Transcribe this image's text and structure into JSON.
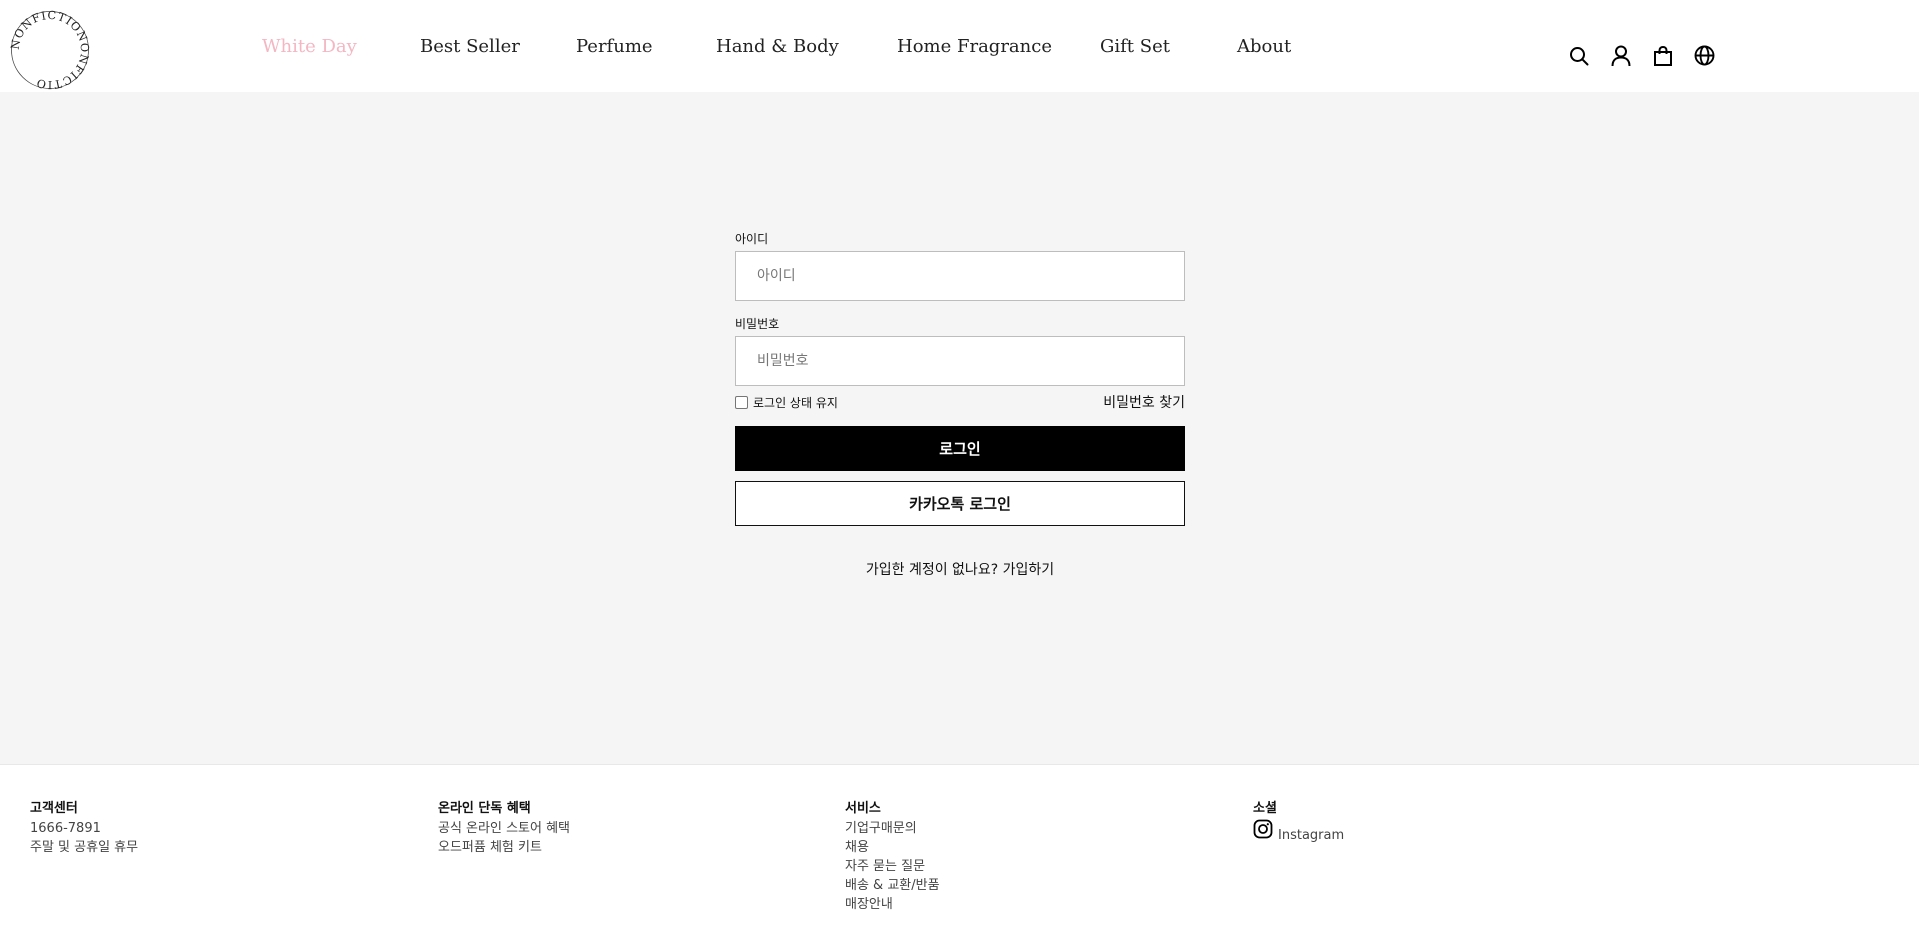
{
  "header": {
    "logo_text": "NONFICTION",
    "nav": [
      {
        "label": "White Day",
        "active": true
      },
      {
        "label": "Best Seller"
      },
      {
        "label": "Perfume"
      },
      {
        "label": "Hand & Body"
      },
      {
        "label": "Home Fragrance"
      },
      {
        "label": "Gift Set"
      },
      {
        "label": "About"
      }
    ],
    "icons": [
      "search-icon",
      "user-icon",
      "shopping-bag-icon",
      "globe-icon"
    ]
  },
  "login": {
    "id_label": "아이디",
    "id_placeholder": "아이디",
    "password_label": "비밀번호",
    "password_placeholder": "비밀번호",
    "keep_logged_in": "로그인 상태 유지",
    "find_password": "비밀번호 찾기",
    "login_button": "로그인",
    "kakao_button": "카카오톡 로그인",
    "signup_prompt": "가입한 계정이 없나요? 가입하기"
  },
  "footer": {
    "customer_center": {
      "title": "고객센터",
      "items": [
        "1666-7891",
        "주말 및 공휴일 휴무"
      ]
    },
    "online_benefits": {
      "title": "온라인 단독 혜택",
      "items": [
        "공식 온라인 스토어 혜택",
        "오드퍼퓸 체험 키트"
      ]
    },
    "services": {
      "title": "서비스",
      "items": [
        "기업구매문의",
        "채용",
        "자주 묻는 질문",
        "배송 & 교환/반품",
        "매장안내"
      ]
    },
    "social": {
      "title": "소셜",
      "instagram": "Instagram"
    }
  },
  "colors": {
    "accent_nav": "#f4b6c2",
    "page_bg": "#f5f5f5",
    "button_black": "#000000"
  }
}
